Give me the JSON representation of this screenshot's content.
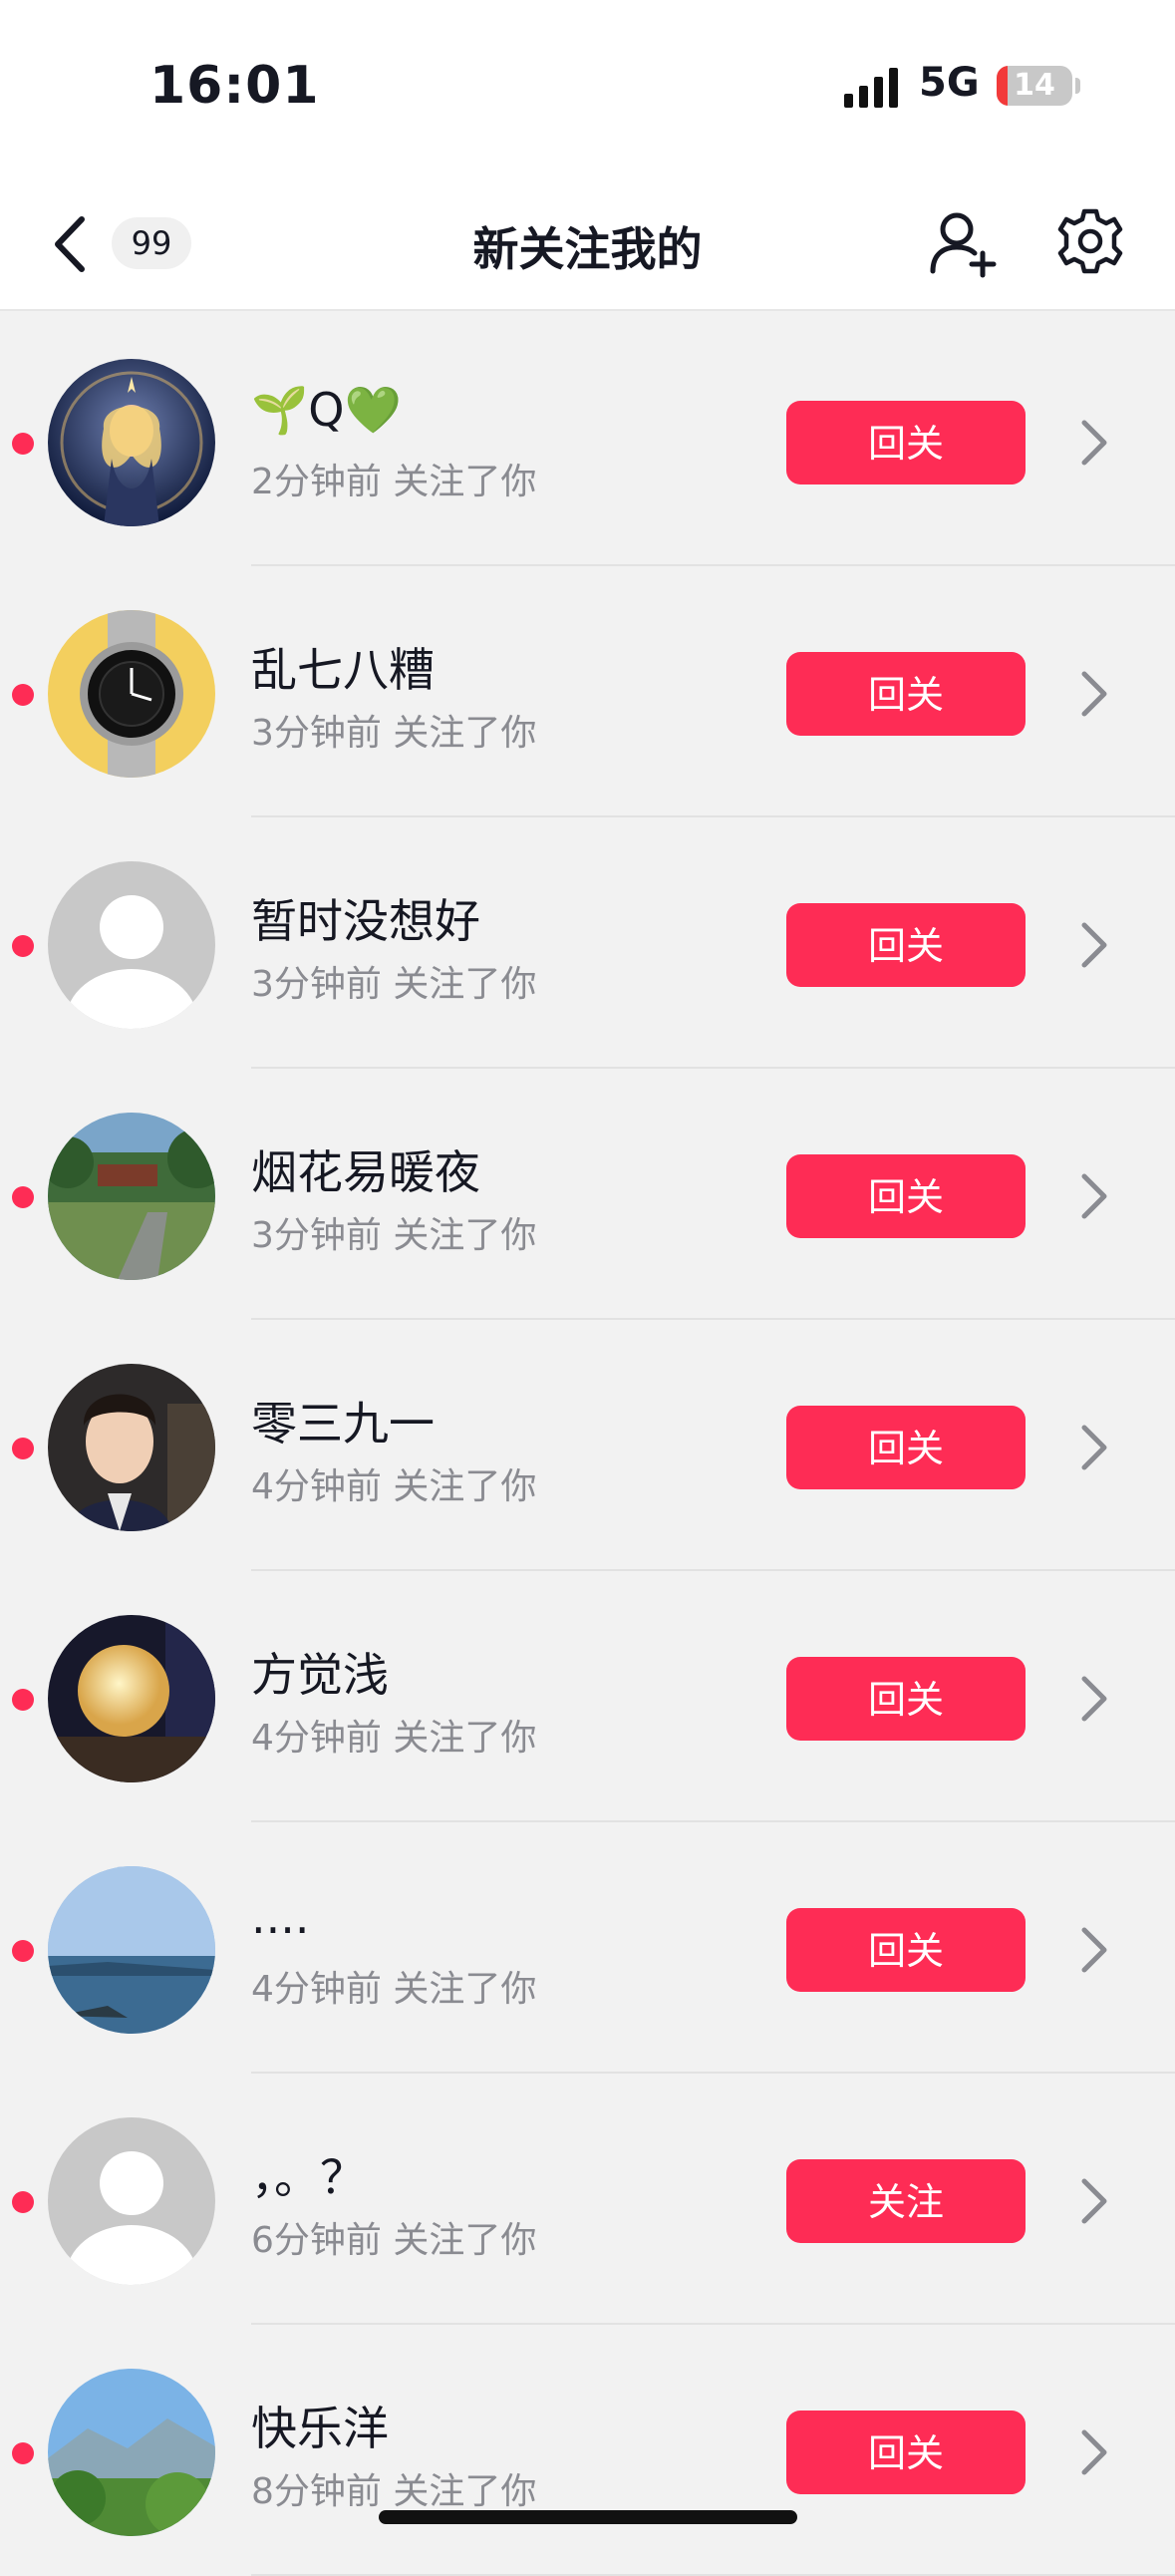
{
  "status": {
    "time": "16:01",
    "network": "5G",
    "battery": "14",
    "battery_level": 0.14
  },
  "header": {
    "title": "新关注我的",
    "badge": "99"
  },
  "colors": {
    "accent": "#fe2c55",
    "unread": "#fe2c55"
  },
  "followers": [
    {
      "name": "🌱Q💚",
      "time": "2分钟前 关注了你",
      "button": "回关"
    },
    {
      "name": "乱七八糟",
      "time": "3分钟前 关注了你",
      "button": "回关"
    },
    {
      "name": "暂时没想好",
      "time": "3分钟前 关注了你",
      "button": "回关"
    },
    {
      "name": "烟花易暖夜",
      "time": "3分钟前 关注了你",
      "button": "回关"
    },
    {
      "name": "零三九一",
      "time": "4分钟前 关注了你",
      "button": "回关"
    },
    {
      "name": "方觉浅",
      "time": "4分钟前 关注了你",
      "button": "回关"
    },
    {
      "name": "....",
      "time": "4分钟前 关注了你",
      "button": "回关"
    },
    {
      "name": "，。？",
      "time": "6分钟前 关注了你",
      "button": "关注"
    },
    {
      "name": "快乐洋",
      "time": "8分钟前 关注了你",
      "button": "回关"
    }
  ]
}
